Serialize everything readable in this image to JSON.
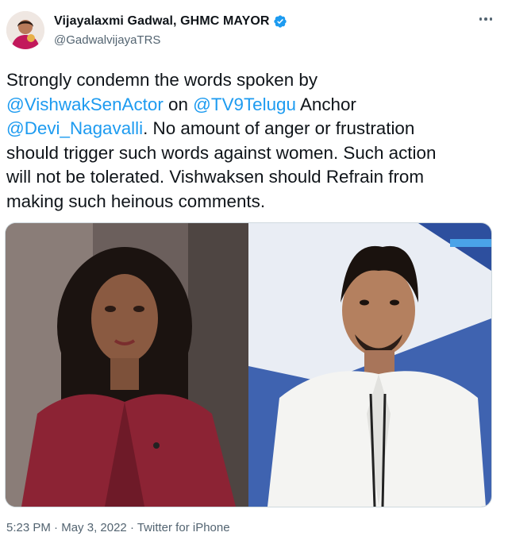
{
  "author": {
    "display_name": "Vijayalaxmi Gadwal, GHMC MAYOR",
    "handle": "@GadwalvijayaTRS",
    "verified": true
  },
  "tweet": {
    "line1_a": "Strongly condemn the words spoken by",
    "mention1": "@VishwakSenActor",
    "line2_mid": " on ",
    "mention2": "@TV9Telugu",
    "line2_end": " Anchor",
    "mention3": "@Devi_Nagavalli",
    "line3_end": ". No amount of anger or frustration",
    "line4": "should trigger such words against women. Such action",
    "line5": "will not be tolerated. Vishwaksen should Refrain from",
    "line6": "making such heinous comments."
  },
  "meta": {
    "time": "5:23 PM",
    "separator1": " · ",
    "date": "May 3, 2022",
    "separator2": " · ",
    "source": "Twitter for iPhone"
  },
  "colors": {
    "link": "#1d9bf0",
    "text": "#0f1419",
    "secondary": "#536471",
    "verified": "#1d9bf0"
  },
  "icons": {
    "verified": "verified-badge-icon",
    "more": "more-options-icon"
  }
}
